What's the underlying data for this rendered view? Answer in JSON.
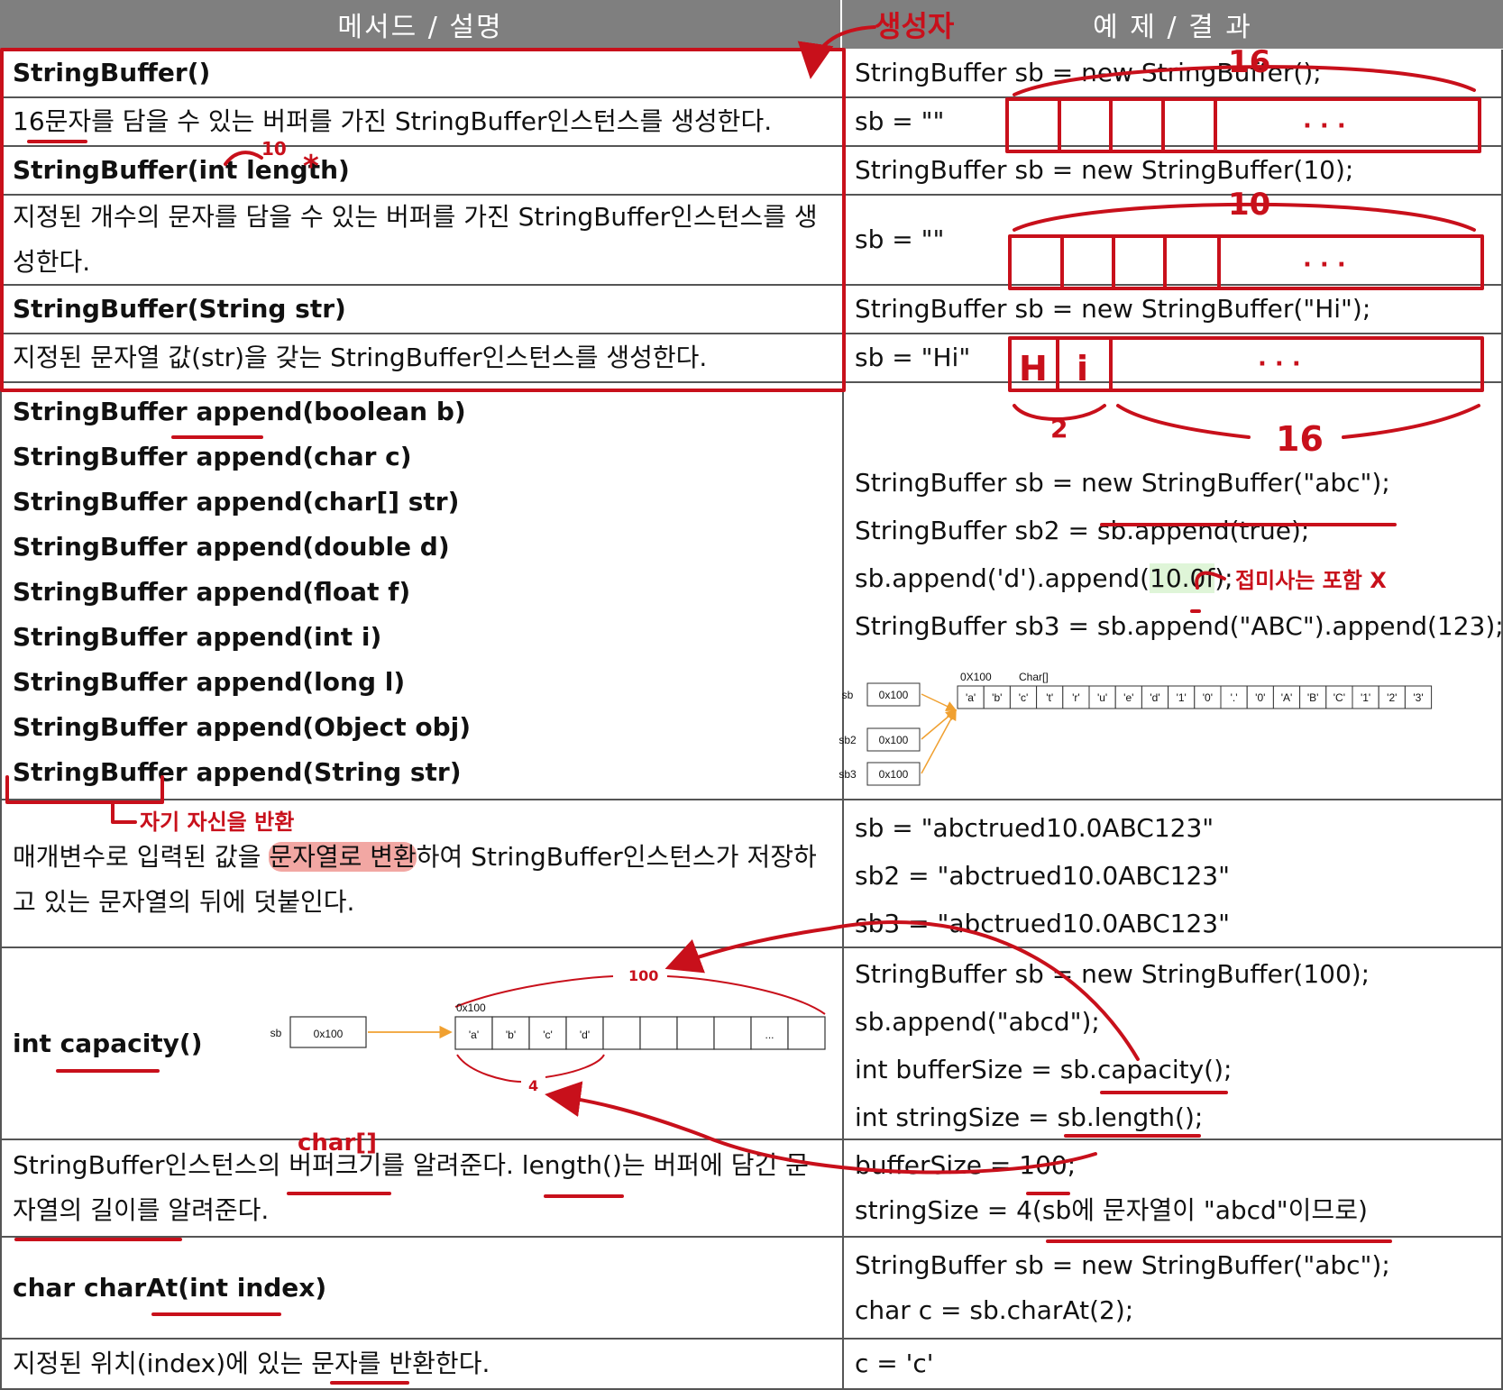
{
  "header": {
    "left": "메서드 / 설명",
    "right": "예 제 / 결 과"
  },
  "rows": {
    "ctor1": {
      "sig": "StringBuffer()",
      "desc": "16문자를 담을 수 있는 버퍼를 가진 StringBuffer인스턴스를 생성한다.",
      "code": "StringBuffer sb = new StringBuffer();",
      "result": "sb = \"\""
    },
    "ctor2": {
      "sig": "StringBuffer(int length)",
      "desc": "지정된 개수의 문자를 담을 수 있는 버퍼를 가진 StringBuffer인스턴스를 생성한다.",
      "code": "StringBuffer sb = new StringBuffer(10);",
      "result": "sb = \"\""
    },
    "ctor3": {
      "sig": "StringBuffer(String str)",
      "desc": "지정된 문자열 값(str)을 갖는 StringBuffer인스턴스를 생성한다.",
      "code": "StringBuffer sb = new StringBuffer(\"Hi\");",
      "result": "sb = \"Hi\""
    },
    "append": {
      "sigs": [
        "StringBuffer append(boolean b)",
        "StringBuffer append(char c)",
        "StringBuffer append(char[] str)",
        "StringBuffer append(double d)",
        "StringBuffer append(float f)",
        "StringBuffer append(int i)",
        "StringBuffer append(long l)",
        "StringBuffer append(Object obj)",
        "StringBuffer append(String str)"
      ],
      "desc_pre": "매개변수로 입력된 값을",
      "desc_hl": "문자열로 변환",
      "desc_post": "하여 StringBuffer인스턴스가 저장하고 있는 문자열의 뒤에 덧붙인다.",
      "code": [
        "StringBuffer sb = new StringBuffer(\"abc\");",
        "StringBuffer sb2 = sb.append(true);",
        "sb.append('d').append(10.0f);",
        "StringBuffer sb3 = sb.append(\"ABC\").append(123);"
      ],
      "results": [
        "sb = \"abctrued10.0ABC123\"",
        "sb2 = \"abctrued10.0ABC123\"",
        "sb3 = \"abctrued10.0ABC123\""
      ],
      "mem_refs": [
        "sb",
        "sb2",
        "sb3"
      ],
      "mem_addr": "0x100",
      "mem_chars": [
        "'a'",
        "'b'",
        "'c'",
        "'t'",
        "'r'",
        "'u'",
        "'e'",
        "'d'",
        "'1'",
        "'0'",
        "'.'",
        "'0'",
        "'A'",
        "'B'",
        "'C'",
        "'1'",
        "'2'",
        "'3'"
      ]
    },
    "capacity": {
      "sig": "int capacity()",
      "desc": "StringBuffer인스턴스의 버퍼크기를 알려준다. length()는 버퍼에 담긴 문자열의 길이를 알려준다.",
      "code": [
        "StringBuffer sb = new StringBuffer(100);",
        "sb.append(\"abcd\");",
        "int bufferSize = sb.capacity();",
        "int stringSize = sb.length();"
      ],
      "results": [
        "bufferSize = 100;",
        "stringSize = 4(sb에 문자열이 \"abcd\"이므로)"
      ],
      "diag_ref": "sb",
      "diag_addr": "0x100",
      "diag_chars": [
        "'a'",
        "'b'",
        "'c'",
        "'d'",
        "",
        "",
        "",
        "",
        "...",
        ""
      ],
      "diag_cap": "100",
      "diag_len": "4"
    },
    "charat": {
      "sig": "char charAt(int index)",
      "desc": "지정된 위치(index)에 있는 문자를 반환한다.",
      "code": [
        "StringBuffer sb = new StringBuffer(\"abc\");",
        "char c = sb.charAt(2);"
      ],
      "result": "c = 'c'"
    }
  },
  "annotations": {
    "ctor_label": "생성자",
    "n16": "16",
    "n10_small": "10",
    "n10": "10",
    "n2": "2",
    "n16b": "16",
    "dots": "· · ·",
    "hi_h": "H",
    "hi_i": "i",
    "self_return": "자기 자신을 반환",
    "suffix_note": "접미사는 포함 X",
    "charr": "char[]",
    "mem_0x100": "0X100",
    "mem_charr": "Char[]",
    "asterisk": "*"
  },
  "colors": {
    "ink": "#c8101b",
    "header": "#7f7f7f",
    "arrow": "#f0a030",
    "green_hl": "#dff5d8",
    "red_hl": "#f2a7a3"
  }
}
